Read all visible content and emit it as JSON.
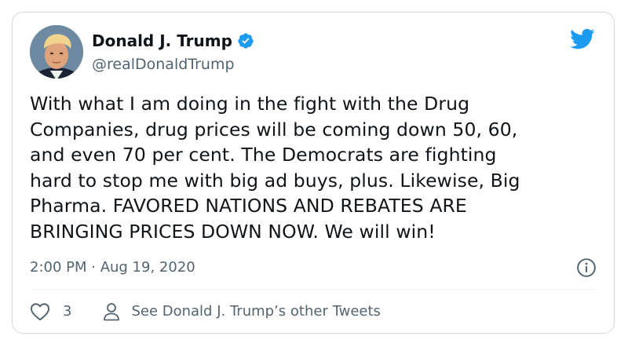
{
  "author": {
    "name": "Donald J. Trump",
    "handle": "@realDonaldTrump",
    "verified": true,
    "avatar_icon": "avatar-photo"
  },
  "tweet": {
    "text_lines": [
      "With what I am doing in the fight with the Drug",
      "Companies, drug prices will be coming down 50, 60,",
      "and even 70 per cent. The Democrats are fighting",
      "hard to stop me with big ad buys, plus. Likewise, Big",
      "Pharma. FAVORED NATIONS AND REBATES ARE",
      "BRINGING PRICES DOWN NOW. We will win!"
    ],
    "timestamp": "2:00 PM · Aug 19, 2020"
  },
  "actions": {
    "like_count": "3",
    "profile_link": "See Donald J. Trump’s other Tweets"
  },
  "icons": {
    "brand": "twitter-bird-icon",
    "verified": "verified-badge-icon",
    "info": "info-icon",
    "like": "heart-icon",
    "profile": "person-icon"
  },
  "colors": {
    "brand_blue": "#1d9bf0",
    "text_primary": "#0f1419",
    "text_secondary": "#536471",
    "border": "#cfd9de"
  }
}
